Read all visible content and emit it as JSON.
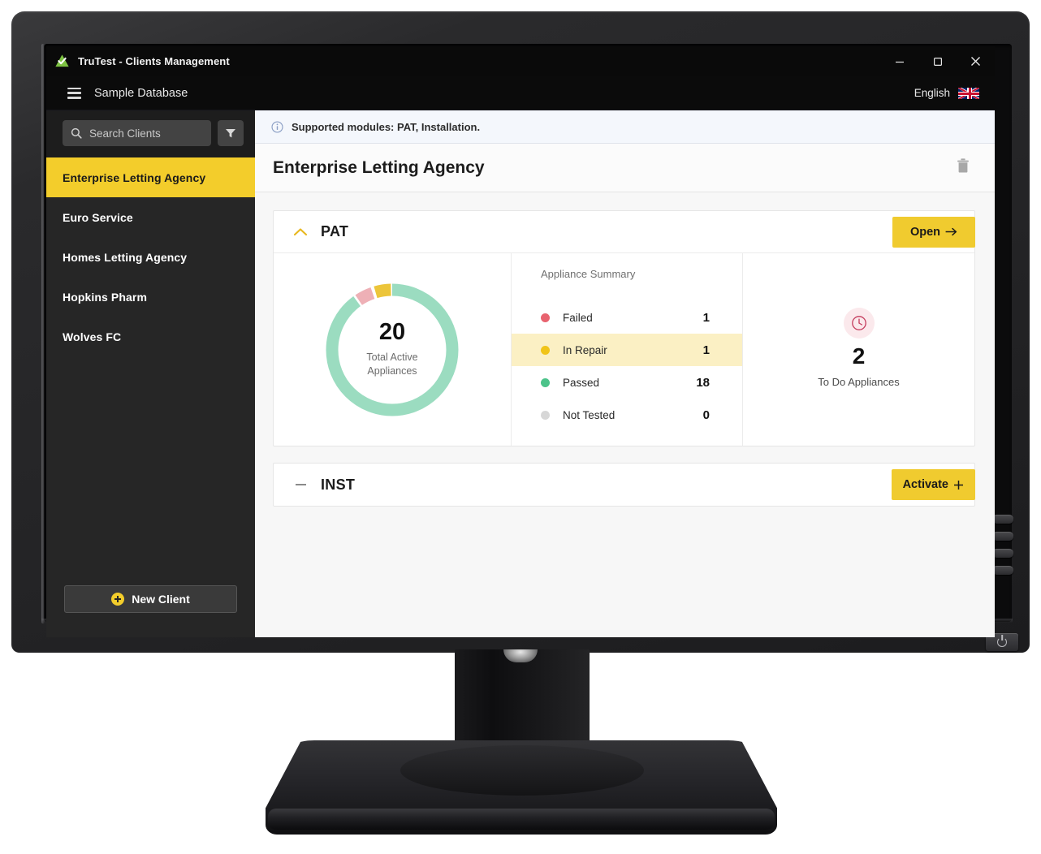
{
  "window": {
    "title": "TruTest - Clients Management",
    "logo_icon": "green-triangle-check-logo",
    "minimize_label": "minimize-icon",
    "maximize_label": "maximize-icon",
    "close_label": "close-icon"
  },
  "topbar": {
    "menu_icon": "hamburger-menu-icon",
    "database_name": "Sample Database",
    "language": "English",
    "flag_icon": "union-jack-flag-icon"
  },
  "sidebar": {
    "search": {
      "icon": "search-icon",
      "placeholder": "Search Clients",
      "value": ""
    },
    "filter_icon": "filter-funnel-icon",
    "clients": [
      {
        "name": "Enterprise Letting Agency",
        "active": true
      },
      {
        "name": "Euro Service",
        "active": false
      },
      {
        "name": "Homes Letting Agency",
        "active": false
      },
      {
        "name": "Hopkins Pharm",
        "active": false
      },
      {
        "name": "Wolves FC",
        "active": false
      }
    ],
    "new_client_label": "New Client",
    "new_client_icon": "plus-circle-icon"
  },
  "main": {
    "info_banner": {
      "icon": "info-circle-icon",
      "text": "Supported modules: PAT, Installation."
    },
    "page_title": "Enterprise Letting Agency",
    "delete_icon": "trash-icon",
    "cards": [
      {
        "id": "pat",
        "title": "PAT",
        "expanded": true,
        "toggle_icon": "chevron-up-icon",
        "action_label": "Open",
        "action_icon": "arrow-right-icon"
      },
      {
        "id": "inst",
        "title": "INST",
        "expanded": false,
        "toggle_icon": "minus-icon",
        "action_label": "Activate",
        "action_icon": "plus-icon"
      }
    ],
    "pat_panel": {
      "donut": {
        "total": "20",
        "label_line1": "Total Active",
        "label_line2": "Appliances"
      },
      "summary_title": "Appliance Summary",
      "summary_rows": [
        {
          "label": "Failed",
          "value": "1",
          "color": "#e8636f",
          "highlight": false
        },
        {
          "label": "In Repair",
          "value": "1",
          "color": "#f0c419",
          "highlight": true
        },
        {
          "label": "Passed",
          "value": "18",
          "color": "#4cc38a",
          "highlight": false
        },
        {
          "label": "Not Tested",
          "value": "0",
          "color": "#d7d7d7",
          "highlight": false
        }
      ],
      "todo": {
        "icon": "clock-icon",
        "count": "2",
        "label": "To Do Appliances"
      }
    }
  },
  "chart_data": {
    "type": "pie",
    "title": "Appliance Summary",
    "center_value": 20,
    "center_label": "Total Active Appliances",
    "categories": [
      "Failed",
      "In Repair",
      "Passed",
      "Not Tested"
    ],
    "values": [
      1,
      1,
      18,
      0
    ],
    "colors": [
      "#eeb0b6",
      "#ecc53a",
      "#9bdcc0",
      "#e2e2e2"
    ],
    "legend_position": "right",
    "grid": false
  },
  "theme": {
    "accent_yellow": "#f0cb2f",
    "sidebar_bg": "#262626",
    "titlebar_bg": "#0a0a0a",
    "donut_green": "#9bdcc0",
    "donut_pink": "#eeb0b6",
    "donut_yellow": "#ecc53a"
  },
  "monitor": {
    "power_icon": "power-icon",
    "buttons": [
      "osd-button-1",
      "osd-button-2",
      "osd-button-3",
      "osd-button-4"
    ]
  }
}
